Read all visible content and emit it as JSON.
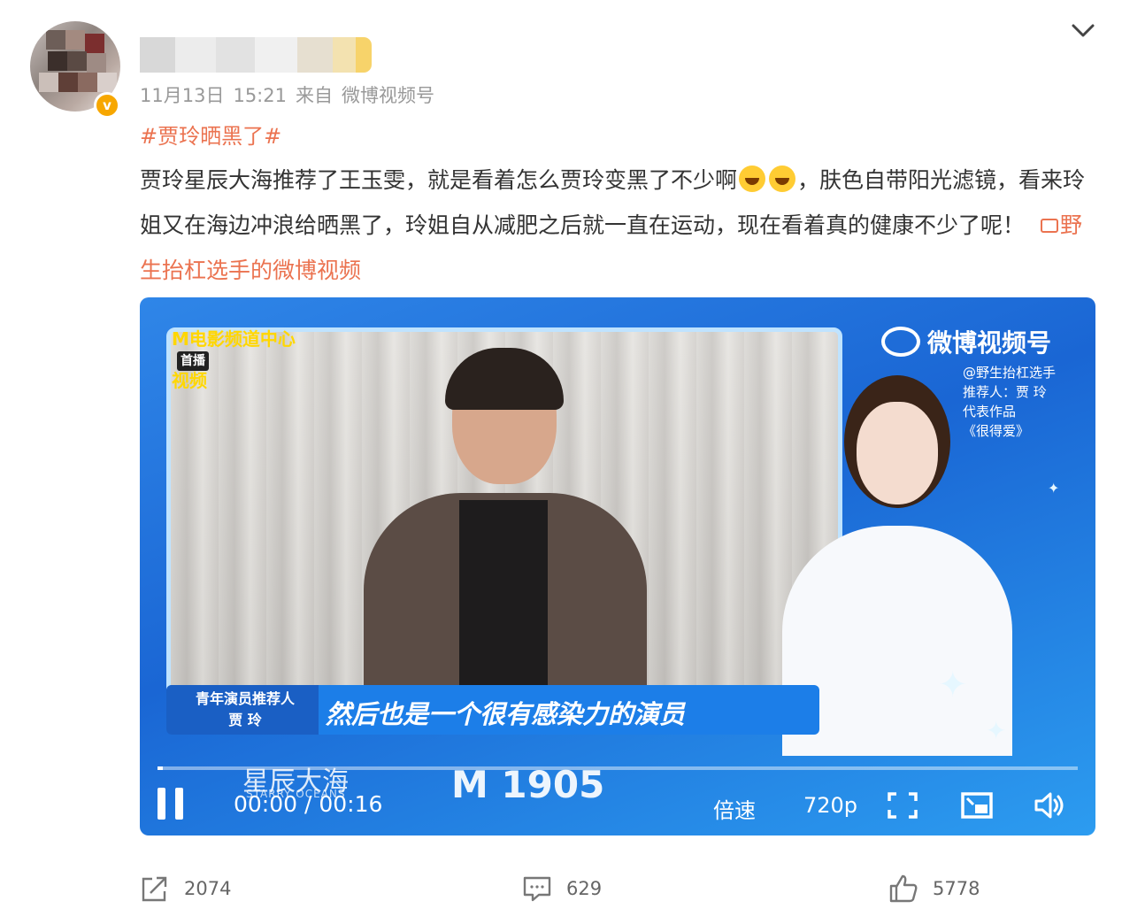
{
  "post": {
    "meta": {
      "date": "11月13日",
      "time": "15:21",
      "source_prefix": "来自",
      "source": "微博视频号"
    },
    "verified_badge": "v",
    "hashtag": "#贾玲晒黑了#",
    "text_part1": "贾玲星辰大海推荐了王玉雯，就是看着怎么贾玲变黑了不少啊",
    "text_part2": "，肤色自带阳光滤镜，看来玲姐又在海边冲浪给晒黑了，玲姐自从减肥之后就一直在运动，现在看着真的健康不少了呢！",
    "video_link": "野生抬杠选手的微博视频"
  },
  "video": {
    "logo_text": "M电影频道中心",
    "logo_sub": "视频",
    "logo_tag": "首播",
    "weibo_mark": "微博视频号",
    "rec_line1": "@野生抬杠选手",
    "rec_line2": "推荐人：贾 玲",
    "rec_line3": "代表作品",
    "rec_line4": "《很得爱》",
    "caption_role_line1": "青年演员推荐人",
    "caption_role_line2": "贾 玲",
    "caption_text": "然后也是一个很有感染力的演员",
    "brand": "星辰大海",
    "brand_sub": "STARRY OCEANS",
    "channel_logo": "M 1905",
    "time": "00:00 / 00:16",
    "progress": 0.0,
    "speed_label": "倍速",
    "quality_label": "720p"
  },
  "actions": {
    "repost_count": "2074",
    "comment_count": "629",
    "like_count": "5778"
  },
  "colors": {
    "accent": "#eb7350",
    "video_blue": "#1a66d4",
    "meta_gray": "#999999",
    "text": "#333333"
  },
  "icons": {
    "collapse": "chevron-down-icon",
    "repost": "share-icon",
    "comment": "comment-icon",
    "like": "thumbs-up-icon",
    "pause": "pause-icon",
    "fullscreen": "fullscreen-icon",
    "pip": "picture-in-picture-icon",
    "volume": "volume-icon"
  }
}
